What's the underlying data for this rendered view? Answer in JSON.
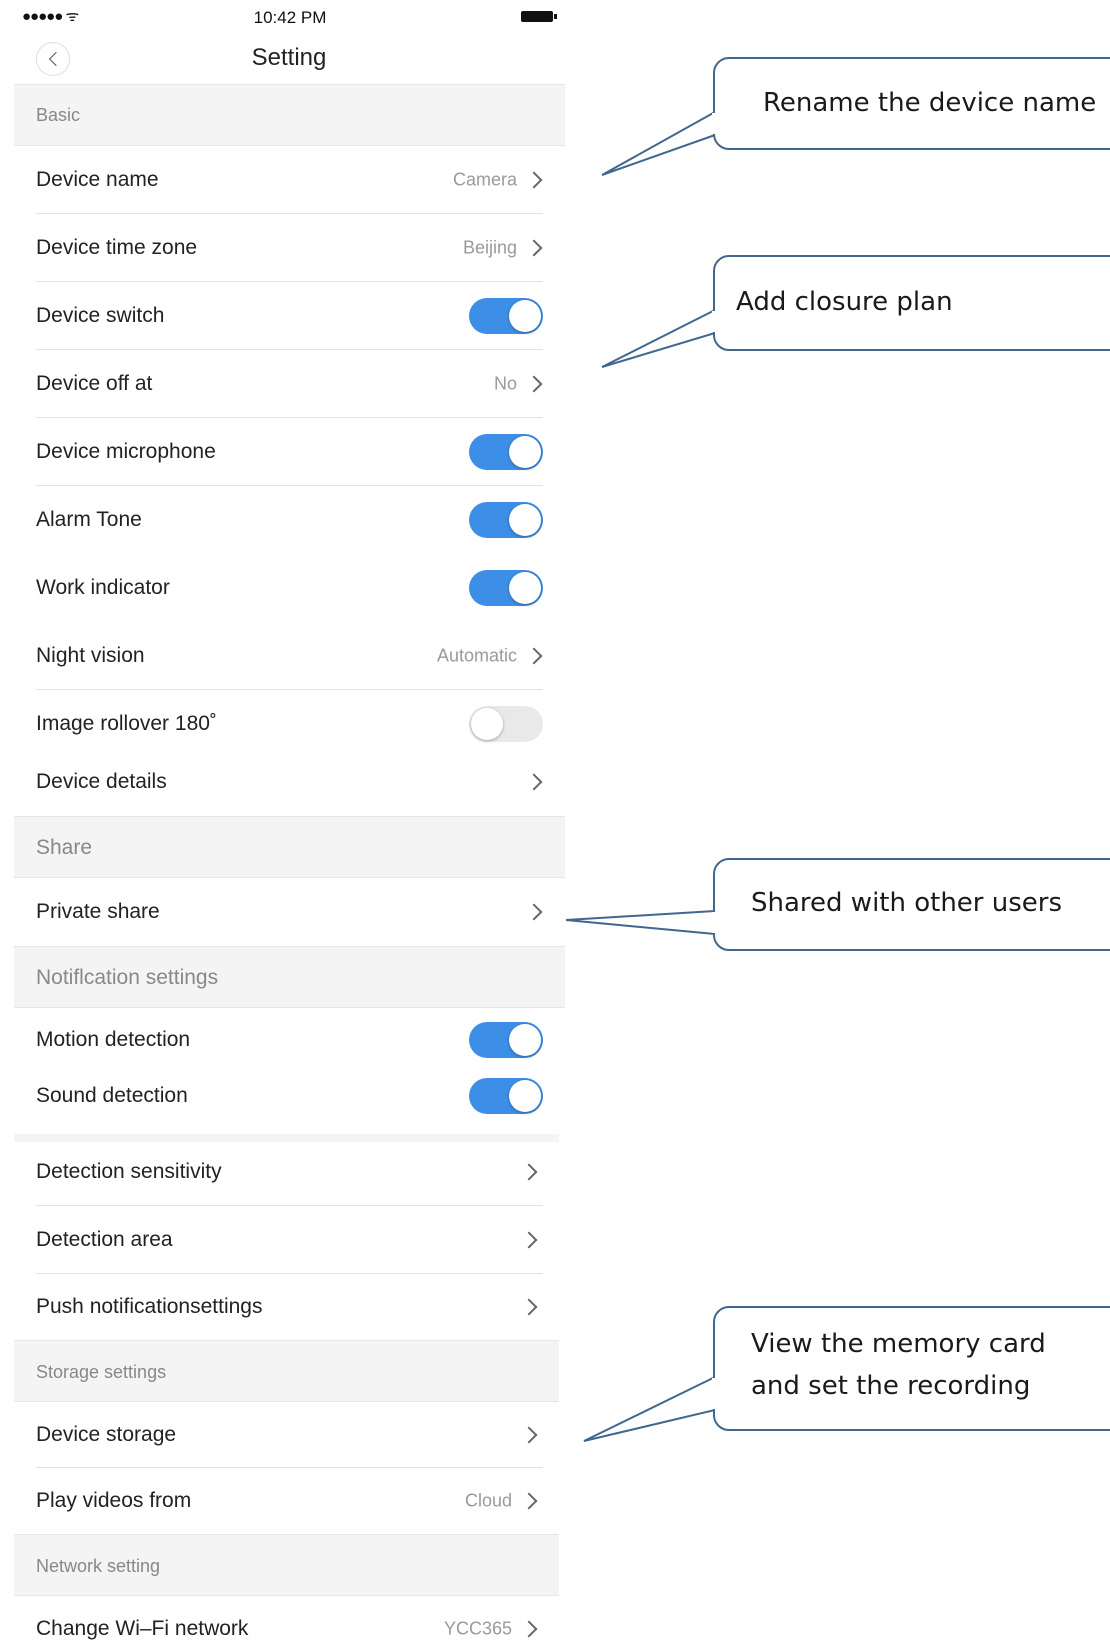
{
  "status": {
    "signal": "●●●●● ᯤ",
    "time": "10:42 PM"
  },
  "header": {
    "title": "Setting"
  },
  "sections": {
    "basic": "Basic",
    "share": "Share",
    "notification": "Notiflcation settings",
    "storage": "Storage settings",
    "network": "Network setting"
  },
  "rows": {
    "device_name": {
      "label": "Device name",
      "value": "Camera"
    },
    "time_zone": {
      "label": "Device time zone",
      "value": "Beijing"
    },
    "device_switch": {
      "label": "Device switch",
      "on": true
    },
    "device_off_at": {
      "label": "Device off at",
      "value": "No"
    },
    "microphone": {
      "label": "Device microphone",
      "on": true
    },
    "alarm_tone": {
      "label": "Alarm Tone",
      "on": true
    },
    "work_indicator": {
      "label": "Work indicator",
      "on": true
    },
    "night_vision": {
      "label": "Night vision",
      "value": "Automatic"
    },
    "image_rollover": {
      "label": "Image rollover 180˚",
      "on": false
    },
    "device_details": {
      "label": "Device details"
    },
    "private_share": {
      "label": "Private share"
    },
    "motion_detection": {
      "label": "Motion detection",
      "on": true
    },
    "sound_detection": {
      "label": "Sound detection",
      "on": true
    },
    "detection_sensitivity": {
      "label": "Detection sensitivity"
    },
    "detection_area": {
      "label": "Detection area"
    },
    "push_notification": {
      "label": "Push notificationsettings"
    },
    "device_storage": {
      "label": "Device storage"
    },
    "play_videos_from": {
      "label": "Play videos from",
      "value": "Cloud"
    },
    "change_wifi": {
      "label": "Change Wi–Fi network",
      "value": "YCC365"
    }
  },
  "callouts": {
    "rename": "Rename the device name",
    "closure": "Add closure plan",
    "shared": "Shared with other users",
    "memory_line1": "View the memory card",
    "memory_line2": "and set the recording"
  },
  "colors": {
    "toggle_on": "#3d8ee6",
    "callout_border": "#41678f"
  },
  "icons": [
    "back-icon",
    "chevron-right-icon",
    "wifi-icon",
    "battery-icon"
  ]
}
